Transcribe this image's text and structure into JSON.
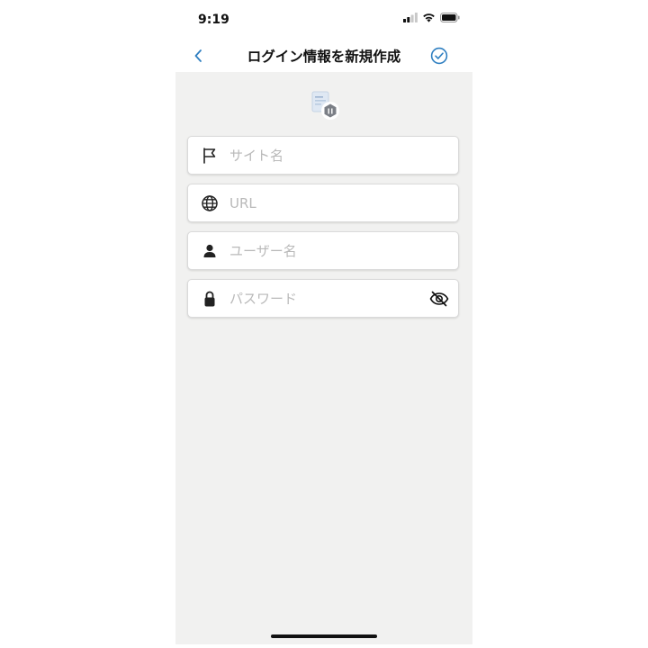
{
  "status_bar": {
    "time": "9:19"
  },
  "nav": {
    "title": "ログイン情報を新規作成",
    "back_icon": "chevron-left-icon",
    "done_icon": "check-circle-icon",
    "accent_color": "#2f7fc1"
  },
  "form": {
    "site_name": {
      "value": "",
      "placeholder": "サイト名",
      "icon": "flag-icon"
    },
    "url": {
      "value": "",
      "placeholder": "URL",
      "icon": "globe-icon"
    },
    "username": {
      "value": "",
      "placeholder": "ユーザー名",
      "icon": "person-icon"
    },
    "password": {
      "value": "",
      "placeholder": "パスワード",
      "icon": "lock-icon",
      "toggle_icon": "eye-slash-icon"
    }
  },
  "colors": {
    "background": "#f1f1f0",
    "card": "#ffffff",
    "placeholder": "#b9b9b9"
  }
}
